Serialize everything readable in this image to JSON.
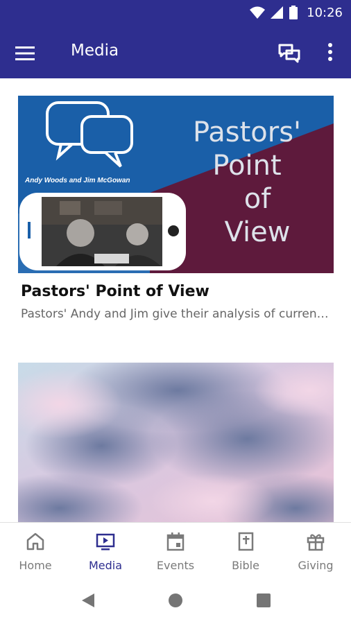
{
  "status_bar": {
    "time": "10:26"
  },
  "app_bar": {
    "title": "Media"
  },
  "cards": [
    {
      "title": "Pastors' Point of View",
      "subtitle": "Pastors' Andy and Jim give their analysis of current events and",
      "image_text": {
        "byline": "Andy Woods and Jim McGowan",
        "headline": [
          "Pastors'",
          "Point",
          "of",
          "View"
        ]
      }
    },
    {
      "title": "",
      "subtitle": ""
    }
  ],
  "bottom_nav": {
    "items": [
      {
        "label": "Home",
        "icon": "home-icon",
        "active": false
      },
      {
        "label": "Media",
        "icon": "tv-play-icon",
        "active": true
      },
      {
        "label": "Events",
        "icon": "calendar-icon",
        "active": false
      },
      {
        "label": "Bible",
        "icon": "bible-icon",
        "active": false
      },
      {
        "label": "Giving",
        "icon": "gift-icon",
        "active": false
      }
    ]
  },
  "colors": {
    "primary": "#2e2e8f",
    "inactive": "#7a7a7a"
  }
}
